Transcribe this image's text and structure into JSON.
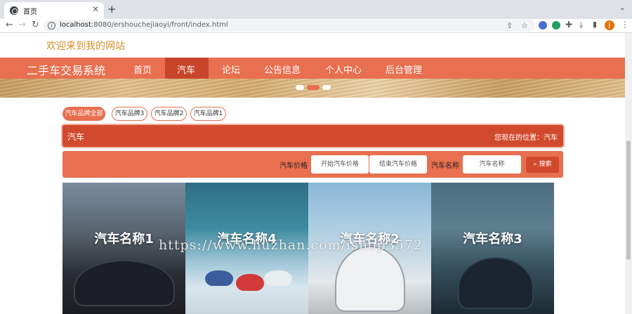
{
  "browser": {
    "tab_title": "首页",
    "url_host": "localhost",
    "url_rest": ":8080/ershouchejiaoyi/front/index.html",
    "profile_letter": "J"
  },
  "header": {
    "welcome": "欢迎来到我的网站",
    "site_title": "二手车交易系统",
    "nav": [
      "首页",
      "汽车",
      "论坛",
      "公告信息",
      "个人中心",
      "后台管理"
    ],
    "active_nav": "汽车"
  },
  "brands": [
    "汽车品牌全部",
    "汽车品牌3",
    "汽车品牌2",
    "汽车品牌1"
  ],
  "title_bar": {
    "left": "汽车",
    "right": "您现在的位置：汽车"
  },
  "search": {
    "price_label": "汽车价格",
    "price_start_placeholder": "开始汽车价格",
    "price_end_placeholder": "结束汽车价格",
    "name_label": "汽车名称",
    "name_placeholder": "汽车名称",
    "button": "搜索"
  },
  "cars": [
    "汽车名称1",
    "汽车名称4",
    "汽车名称2",
    "汽车名称3"
  ],
  "watermark": "https://www.huzhan.com/ishop3572",
  "colors": {
    "primary": "#e86f4f",
    "primary_dark": "#d24a2d",
    "welcome": "#d4912a"
  }
}
